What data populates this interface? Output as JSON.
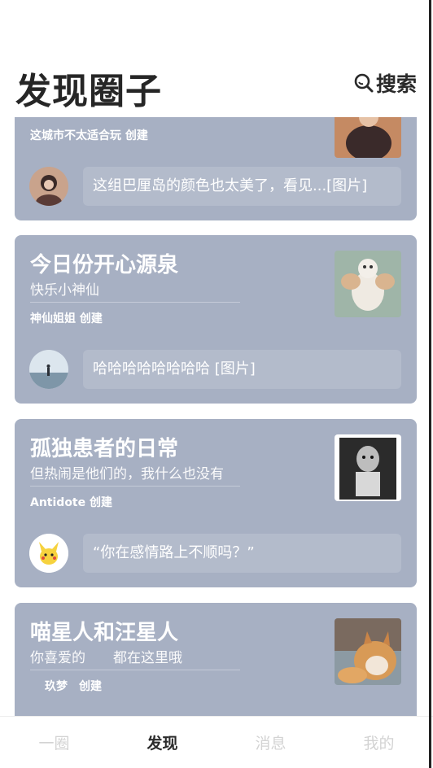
{
  "header": {
    "title": "发现圈子",
    "search_label": "搜索"
  },
  "circles": [
    {
      "title": "",
      "subtitle": "",
      "creator": "这城市不太适合玩 创建",
      "latest_post": "这组巴厘岛的颜色也太美了，看见...[图片]"
    },
    {
      "title": "今日份开心源泉",
      "subtitle": "快乐小神仙",
      "creator": "神仙姐姐 创建",
      "latest_post": "哈哈哈哈哈哈哈哈 [图片]"
    },
    {
      "title": "孤独患者的日常",
      "subtitle": "但热闹是他们的，我什么也没有",
      "creator": "Antidote 创建",
      "latest_post": "“你在感情路上不顺吗？”"
    },
    {
      "title": "喵星人和汪星人",
      "subtitle": "你喜爱的　　都在这里哦",
      "creator": "玖梦　创建",
      "latest_post": ""
    }
  ],
  "tabs": [
    {
      "label": "一圈"
    },
    {
      "label": "发现"
    },
    {
      "label": "消息"
    },
    {
      "label": "我的"
    }
  ],
  "active_tab": "发现",
  "colors": {
    "card_bg": "#a7b0c3",
    "title_text": "#262626",
    "tab_inactive": "#d3d3d3"
  }
}
